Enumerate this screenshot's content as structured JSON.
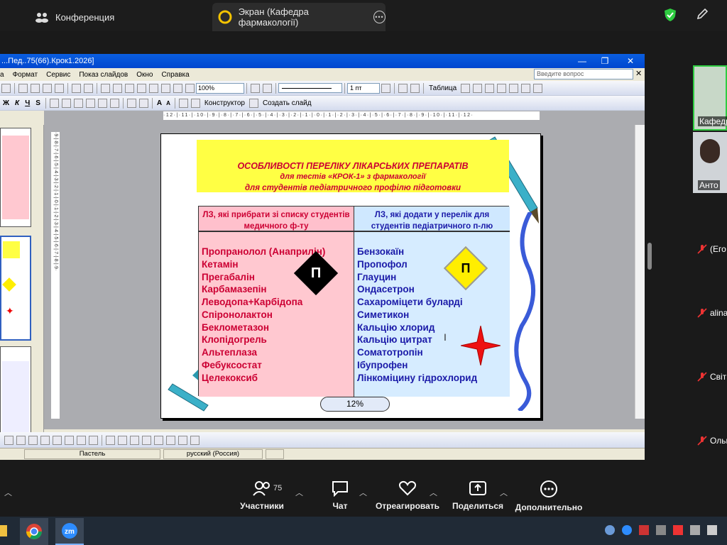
{
  "zoom": {
    "tab_meeting": "Конференция",
    "tab_screen": "Экран (Кафедра фармакології)",
    "participants_count": "75",
    "buttons": {
      "participants": "Участники",
      "chat": "Чат",
      "react": "Отреагировать",
      "share": "Поделиться",
      "more": "Дополнительно"
    },
    "side_participants": [
      "Кафедр",
      "Анто",
      "(Его",
      "alina",
      "Світ",
      "Ольг"
    ]
  },
  "ppt": {
    "title": "...Пед..75(66).Крок1.2026]",
    "menu": [
      "а",
      "Формат",
      "Сервис",
      "Показ слайдов",
      "Окно",
      "Справка"
    ],
    "ask_placeholder": "Введите вопрос",
    "zoom_value": "100%",
    "line_pt": "1 пт",
    "table_label": "Таблица",
    "constructor_label": "Конструктор",
    "create_slide_label": "Создать слайд",
    "status_design": "Пастель",
    "status_lang": "русский (Россия)",
    "ruler_h": "·12·|·11·|·10·|·9·|·8·|·7·|·6·|·5·|·4·|·3·|·2·|·1·|·0·|·1·|·2·|·3·|·4·|·5·|·6·|·7·|·8·|·9·|·10·|·11·|·12·",
    "ruler_v": "·9·|·8·|·7·|·6·|·5·|·4·|·3·|·2·|·1·|·0·|·1·|·2·|·3·|·4·|·5·|·6·|·7·|·8·|·9·"
  },
  "slide": {
    "title_line1": "ОСОБЛИВОСТІ ПЕРЕЛІКУ ЛІКАРСЬКИХ ПРЕПАРАТІВ",
    "title_line2": "для тестів «КРОК-1» з фармакології",
    "title_line3": "для студентів педіатричного профілю підготовки",
    "left_header": "ЛЗ, які прибрати зі списку студентів медичного ф-ту",
    "right_header": "ЛЗ, які додати у перелік для студентів педіатричного п-лю",
    "left_drugs": [
      "Пропранолол (Анаприлін)",
      "Кетамін",
      "Прегабалін",
      "Карбамазепін",
      "Леводопа+Карбідопа",
      "Спіронолактон",
      "Беклометазон",
      "Клопідогрель",
      "Альтеплаза",
      "Фебуксостат",
      "Целекоксиб"
    ],
    "right_drugs": [
      "Бензокаїн",
      "Пропофол",
      "Глауцин",
      "Ондасетрон",
      "Сахароміцети буларді",
      "Симетикон",
      "Кальцію хлорид",
      "Кальцію цитрат",
      "Соматотропін",
      "Ібупрофен",
      "Лінкоміцину гідрохлорид"
    ],
    "diamond_left": "П",
    "diamond_right": "П",
    "percent": "12%"
  },
  "colors": {
    "accent_red": "#cc0033",
    "accent_blue": "#1a1aa8",
    "yellow": "#ffff44"
  }
}
